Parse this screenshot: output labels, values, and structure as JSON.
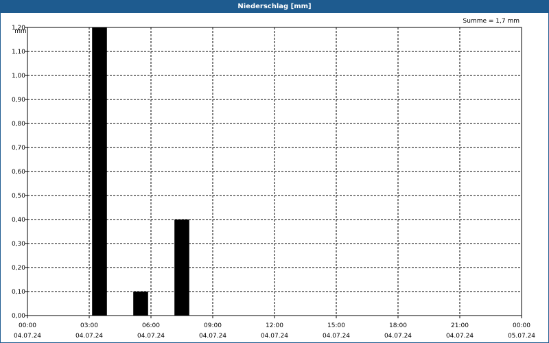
{
  "window": {
    "title": "Niederschlag [mm]"
  },
  "summary": {
    "text": "Summe = 1,7 mm"
  },
  "colors": {
    "titlebar": "#1e5b8f",
    "bars": "#000000",
    "grid": "#000000"
  },
  "chart_data": {
    "type": "bar",
    "title": "Niederschlag [mm]",
    "ylabel": "mm",
    "xlabel": "",
    "ylim": [
      0,
      1.2
    ],
    "grid": true,
    "y_ticks": [
      "0,00",
      "0,10",
      "0,20",
      "0,30",
      "0,40",
      "0,50",
      "0,60",
      "0,70",
      "0,80",
      "0,90",
      "1,00",
      "1,10",
      "1,20"
    ],
    "x_ticks": [
      {
        "time": "00:00",
        "date": "04.07.24"
      },
      {
        "time": "03:00",
        "date": "04.07.24"
      },
      {
        "time": "06:00",
        "date": "04.07.24"
      },
      {
        "time": "09:00",
        "date": "04.07.24"
      },
      {
        "time": "12:00",
        "date": "04.07.24"
      },
      {
        "time": "15:00",
        "date": "04.07.24"
      },
      {
        "time": "18:00",
        "date": "04.07.24"
      },
      {
        "time": "21:00",
        "date": "04.07.24"
      },
      {
        "time": "00:00",
        "date": "05.07.24"
      }
    ],
    "xlim": [
      "2024-07-04 00:00",
      "2024-07-05 00:00"
    ],
    "interval_hours": 1,
    "bars": [
      {
        "start": "2024-07-04 03:00",
        "value": 1.2
      },
      {
        "start": "2024-07-04 05:00",
        "value": 0.1
      },
      {
        "start": "2024-07-04 07:00",
        "value": 0.4
      }
    ]
  }
}
